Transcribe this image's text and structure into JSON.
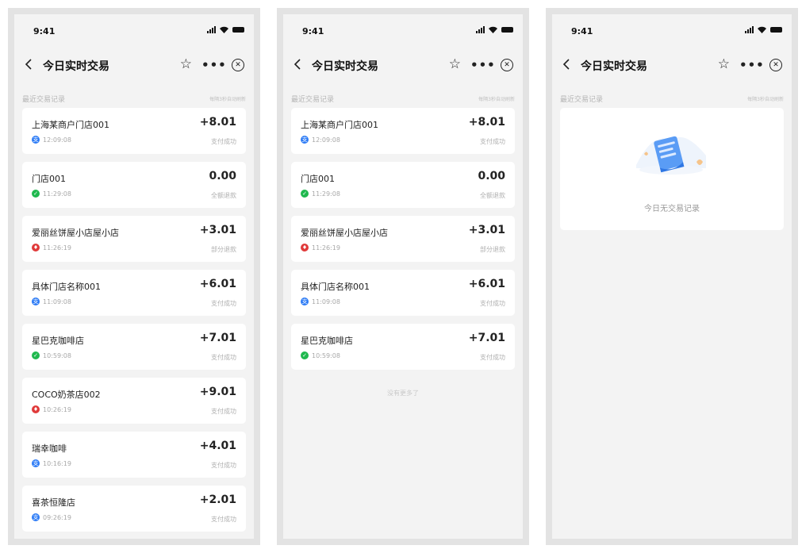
{
  "colors": {
    "alipay_blue": "#2e7cf6",
    "wechat_green": "#1fb84e",
    "unionpay_red": "#e03a3a"
  },
  "screens": [
    {
      "status_time": "9:41",
      "title": "今日实时交易",
      "section_title": "最近交易记录",
      "refresh_note": "每隔3秒自动刷新",
      "transactions": [
        {
          "merchant": "上海某商户门店001",
          "amount": "+8.01",
          "time": "12:09:08",
          "status": "支付成功",
          "method_icon": "alipay-icon"
        },
        {
          "merchant": "门店001",
          "amount": "0.00",
          "time": "11:29:08",
          "status": "全额退款",
          "method_icon": "wechat-pay-icon"
        },
        {
          "merchant": "爱丽丝饼屋小店屋小店",
          "amount": "+3.01",
          "time": "11:26:19",
          "status": "部分退款",
          "method_icon": "unionpay-icon"
        },
        {
          "merchant": "具体门店名称001",
          "amount": "+6.01",
          "time": "11:09:08",
          "status": "支付成功",
          "method_icon": "alipay-icon"
        },
        {
          "merchant": "星巴克咖啡店",
          "amount": "+7.01",
          "time": "10:59:08",
          "status": "支付成功",
          "method_icon": "wechat-pay-icon"
        },
        {
          "merchant": "COCO奶茶店002",
          "amount": "+9.01",
          "time": "10:26:19",
          "status": "支付成功",
          "method_icon": "unionpay-icon"
        },
        {
          "merchant": "瑞幸咖啡",
          "amount": "+4.01",
          "time": "10:16:19",
          "status": "支付成功",
          "method_icon": "alipay-icon"
        },
        {
          "merchant": "喜茶恒隆店",
          "amount": "+2.01",
          "time": "09:26:19",
          "status": "支付成功",
          "method_icon": "alipay-icon"
        }
      ]
    },
    {
      "status_time": "9:41",
      "title": "今日实时交易",
      "section_title": "最近交易记录",
      "refresh_note": "每隔3秒自动刷新",
      "transactions": [
        {
          "merchant": "上海某商户门店001",
          "amount": "+8.01",
          "time": "12:09:08",
          "status": "支付成功",
          "method_icon": "alipay-icon"
        },
        {
          "merchant": "门店001",
          "amount": "0.00",
          "time": "11:29:08",
          "status": "全额退款",
          "method_icon": "wechat-pay-icon"
        },
        {
          "merchant": "爱丽丝饼屋小店屋小店",
          "amount": "+3.01",
          "time": "11:26:19",
          "status": "部分退款",
          "method_icon": "unionpay-icon"
        },
        {
          "merchant": "具体门店名称001",
          "amount": "+6.01",
          "time": "11:09:08",
          "status": "支付成功",
          "method_icon": "alipay-icon"
        },
        {
          "merchant": "星巴克咖啡店",
          "amount": "+7.01",
          "time": "10:59:08",
          "status": "支付成功",
          "method_icon": "wechat-pay-icon"
        }
      ],
      "footer_note": "没有更多了"
    },
    {
      "status_time": "9:41",
      "title": "今日实时交易",
      "section_title": "最近交易记录",
      "refresh_note": "每隔3秒自动刷新",
      "empty_text": "今日无交易记录"
    }
  ]
}
